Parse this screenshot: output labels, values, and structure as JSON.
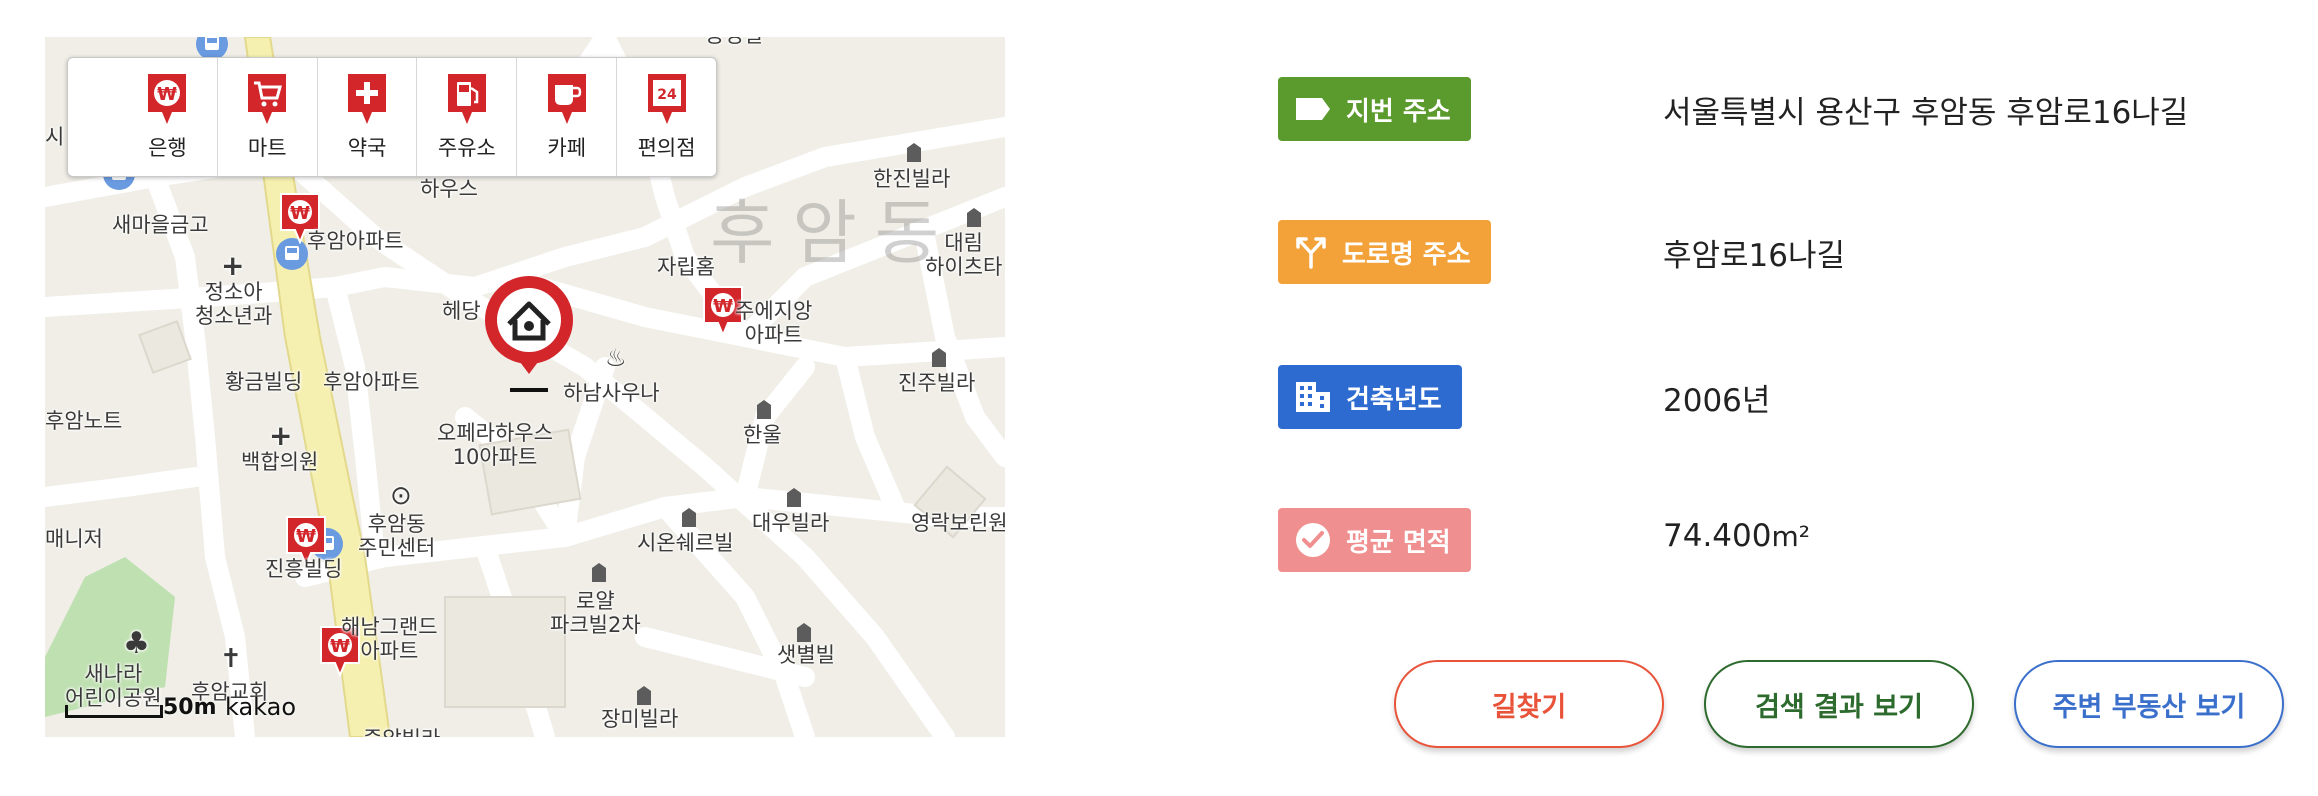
{
  "map": {
    "categories": [
      {
        "label": "은행",
        "icon": "bank-icon"
      },
      {
        "label": "마트",
        "icon": "cart-icon"
      },
      {
        "label": "약국",
        "icon": "pharmacy-icon"
      },
      {
        "label": "주유소",
        "icon": "gas-station-icon"
      },
      {
        "label": "카페",
        "icon": "cafe-icon"
      },
      {
        "label": "편의점",
        "icon": "convenience-store-icon"
      }
    ],
    "pin_24_text": "24",
    "area_label": "후암동",
    "labels": {
      "l1": "하우스",
      "l2": "새마을금고",
      "l3": "후암아파트",
      "l4": "정소아\n청소년과",
      "l5": "헤당",
      "l6": "자립홈",
      "l7": "주에지앙\n아파트",
      "l8": "한진빌라",
      "l9": "대림\n하이츠타",
      "l10": "황금빌딩",
      "l11": "후암아파트",
      "l12": "하남사우나",
      "l13": "진주빌라",
      "l14": "후암노트",
      "l15": "오페라하우스\n10아파트",
      "l16": "한울",
      "l17": "백합의원",
      "l18": "후암동\n주민센터",
      "l19": "대우빌라",
      "l20": "영락보린원",
      "l21": "매니저",
      "l22": "진흥빌딩",
      "l23": "시온쉐르빌",
      "l24": "로얄\n파크빌2차",
      "l25": "해남그랜드\n아파트",
      "l26": "샛별빌",
      "l27": "새나라\n어린이공원",
      "l28": "후암교회",
      "l29": "장미빌라",
      "l30": "중앙빌라",
      "l31": "시",
      "l32": "용성빌"
    },
    "scale": "50m",
    "logo": "kakao"
  },
  "info": {
    "jibun": {
      "label": "지번 주소",
      "value": "서울특별시 용산구 후암동 후암로16나길",
      "color": "#5b9a2c"
    },
    "road": {
      "label": "도로명 주소",
      "value": "후암로16나길",
      "color": "#f3a23a"
    },
    "year": {
      "label": "건축년도",
      "value": "2006년",
      "color": "#2e6bd0"
    },
    "area": {
      "label": "평균 면적",
      "value": "74.400",
      "unit": "m²",
      "color": "#f08f8f"
    }
  },
  "actions": {
    "directions": {
      "label": "길찾기",
      "color": "#e8533a"
    },
    "results": {
      "label": "검색 결과 보기",
      "color": "#2d6a2d"
    },
    "nearby": {
      "label": "주변 부동산 보기",
      "color": "#3a6fcb"
    }
  }
}
